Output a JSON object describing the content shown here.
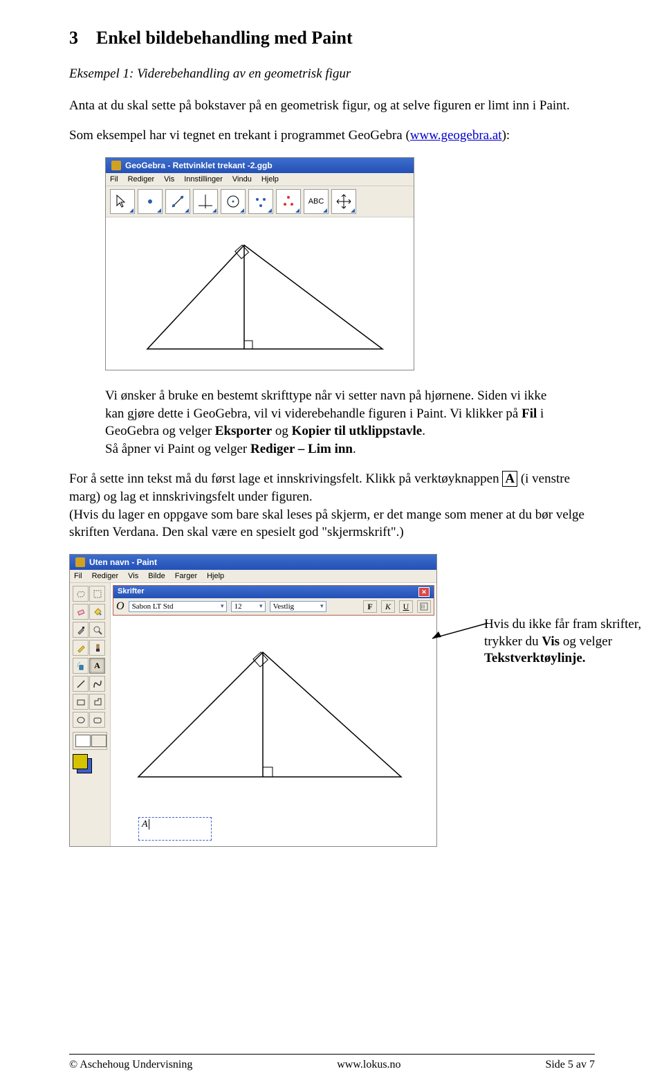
{
  "heading_num": "3",
  "heading": "Enkel bildebehandling med Paint",
  "subtitle": "Eksempel 1: Viderebehandling av en geometrisk figur",
  "para1": "Anta at du skal sette på bokstaver på en geometrisk figur, og at selve figuren er limt inn i Paint.",
  "para2_a": "Som eksempel har vi tegnet en trekant i programmet GeoGebra (",
  "para2_link": "www.geogebra.at",
  "para2_b": "):",
  "gg": {
    "title": "GeoGebra - Rettvinklet trekant -2.ggb",
    "menu": [
      "Fil",
      "Rediger",
      "Vis",
      "Innstillinger",
      "Vindu",
      "Hjelp"
    ],
    "abc": "ABC"
  },
  "para3_a": "Vi ønsker å bruke en bestemt skrifttype når vi setter navn på hjørnene. Siden vi ikke kan gjøre dette i GeoGebra, vil vi viderebehandle figuren i Paint. Vi klikker på ",
  "para3_b1": "Fil",
  "para3_c": " i GeoGebra og velger ",
  "para3_b2": "Eksporter",
  "para3_d": " og ",
  "para3_b3": "Kopier til utklippstavle",
  "para3_e": ".",
  "para3_f": "Så åpner vi Paint og velger ",
  "para3_b4": "Rediger – Lim inn",
  "para3_g": ".",
  "para4_a": "For å sette inn tekst må du først lage et innskrivingsfelt. Klikk på verktøyknappen ",
  "para4_box": "A",
  "para4_b": " (i venstre marg) og lag et innskrivingsfelt under figuren.",
  "para4_c": "(Hvis du lager en oppgave som bare skal leses på skjerm, er det mange som mener at du bør velge skriften Verdana. Den skal være en spesielt god \"skjermskrift\".)",
  "paint": {
    "title": "Uten navn - Paint",
    "menu": [
      "Fil",
      "Rediger",
      "Vis",
      "Bilde",
      "Farger",
      "Hjelp"
    ],
    "font_title": "Skrifter",
    "font_name": "Sabon LT Std",
    "font_size": "12",
    "font_script": "Vestlig",
    "bold": "F",
    "italic": "K",
    "underline": "U",
    "cursor_text": "A"
  },
  "annotation_a": "Hvis du ikke får fram skrifter, trykker du ",
  "annotation_b1": "Vis",
  "annotation_b": " og velger ",
  "annotation_b2": "Tekstverktøylinje.",
  "footer": {
    "left": "© Aschehoug Undervisning",
    "center": "www.lokus.no",
    "right": "Side 5 av 7"
  }
}
